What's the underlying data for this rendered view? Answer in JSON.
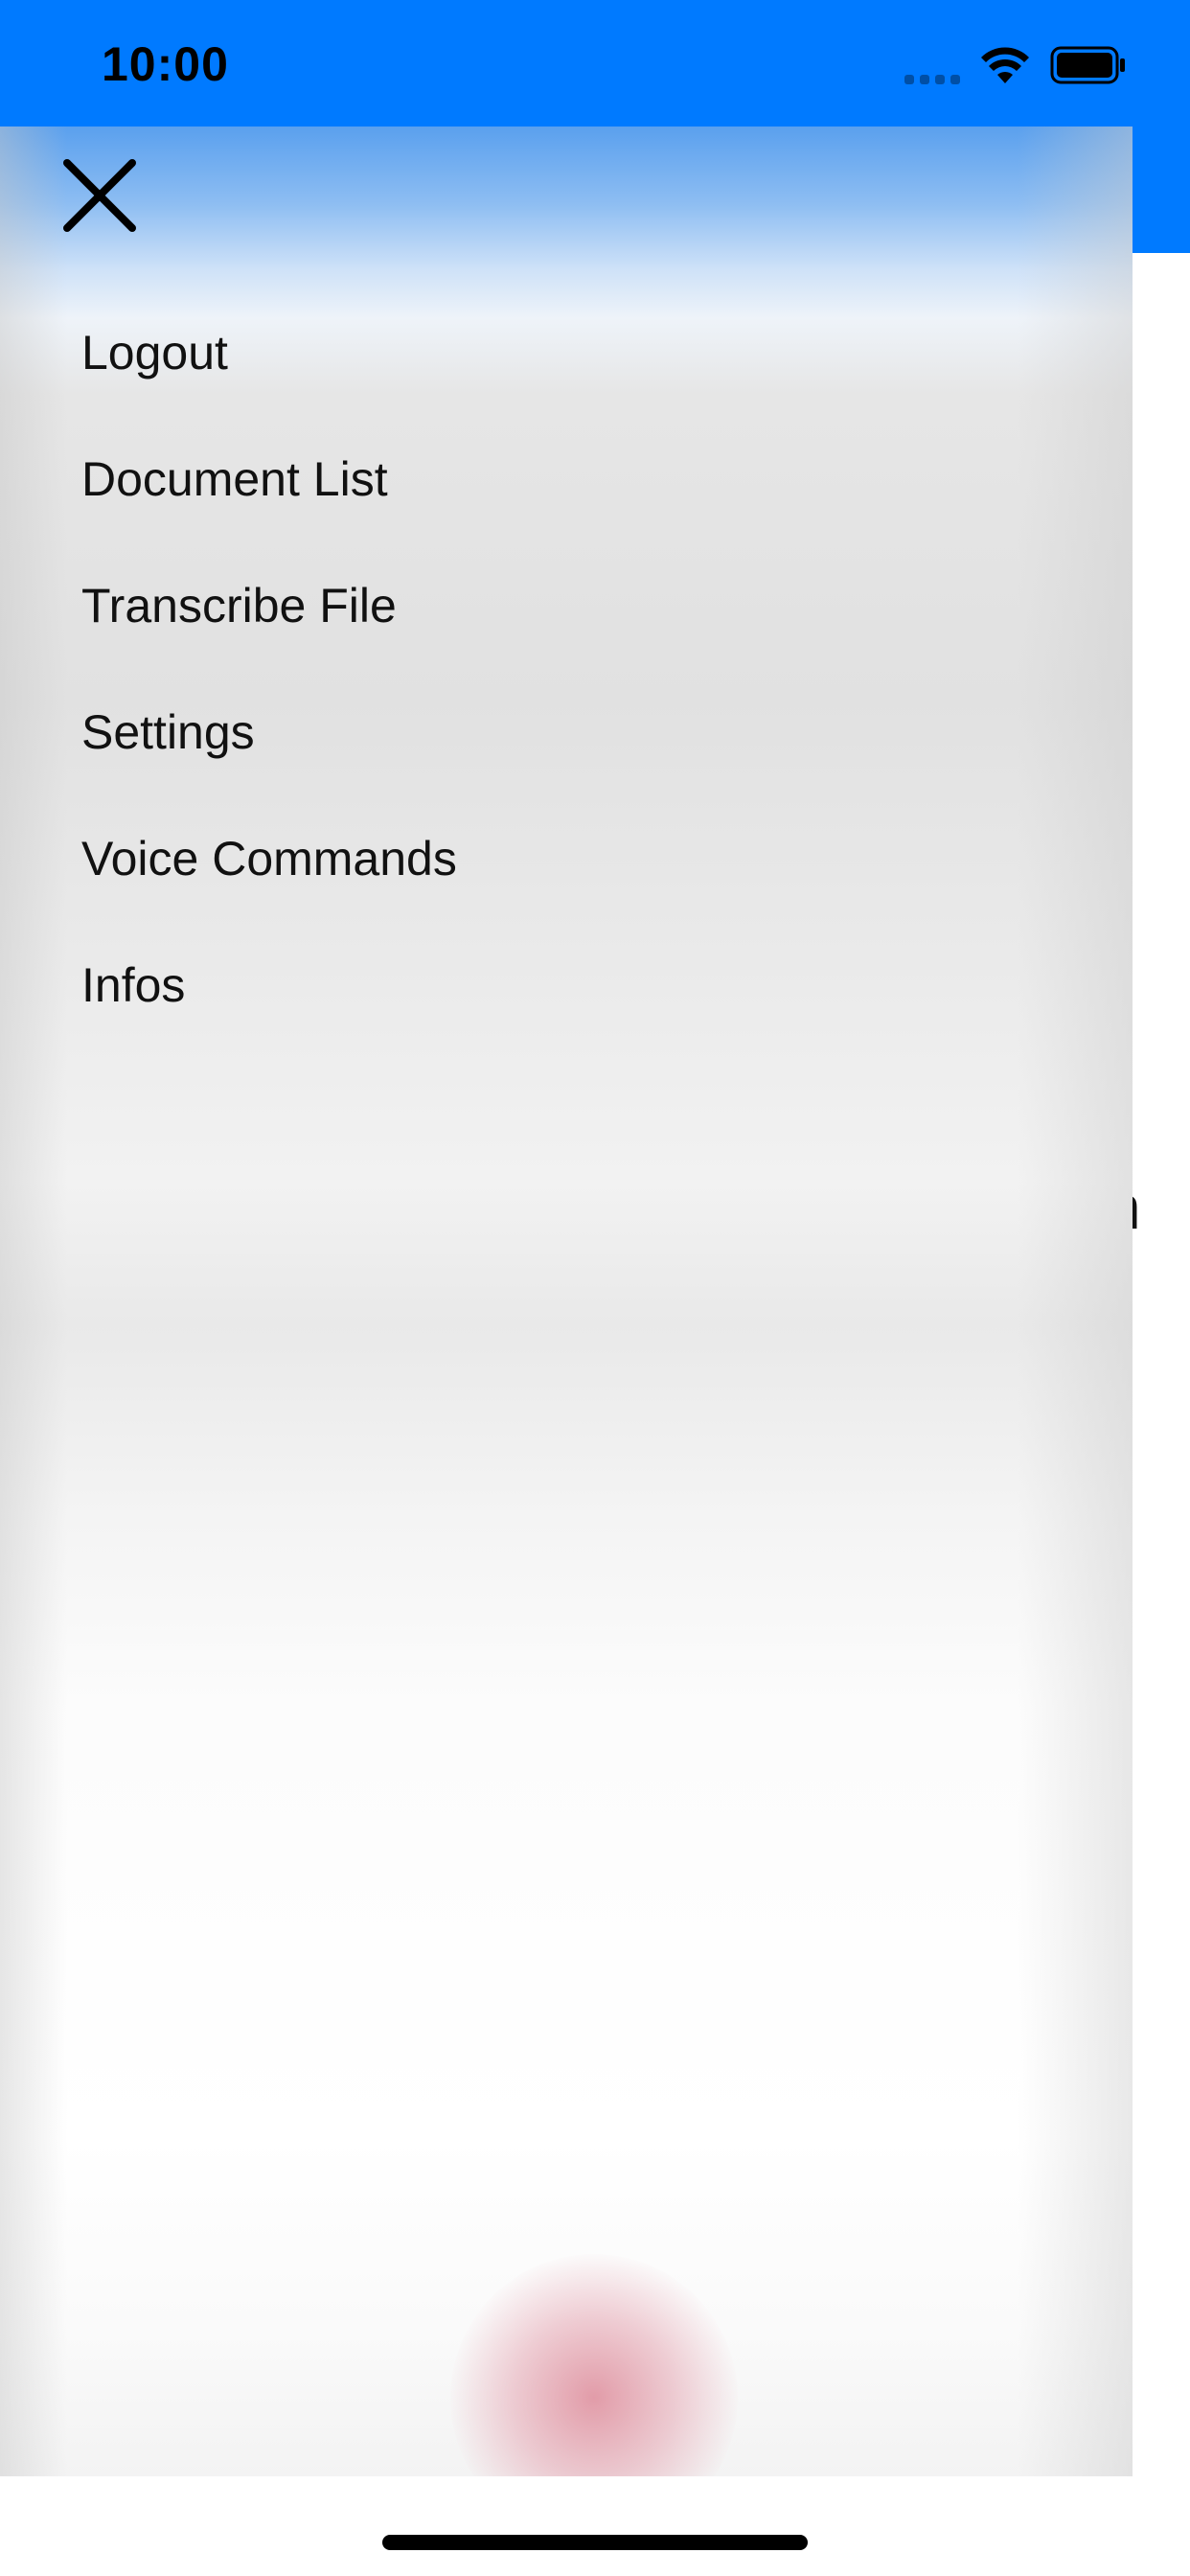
{
  "status_bar": {
    "time": "10:00"
  },
  "background": {
    "peek_text": "n"
  },
  "drawer": {
    "close_icon": "close-icon",
    "menu_items": [
      {
        "label": "Logout"
      },
      {
        "label": "Document List"
      },
      {
        "label": "Transcribe File"
      },
      {
        "label": "Settings"
      },
      {
        "label": "Voice Commands"
      },
      {
        "label": "Infos"
      }
    ]
  },
  "colors": {
    "nav_blue": "#007aff",
    "text": "#111111"
  }
}
